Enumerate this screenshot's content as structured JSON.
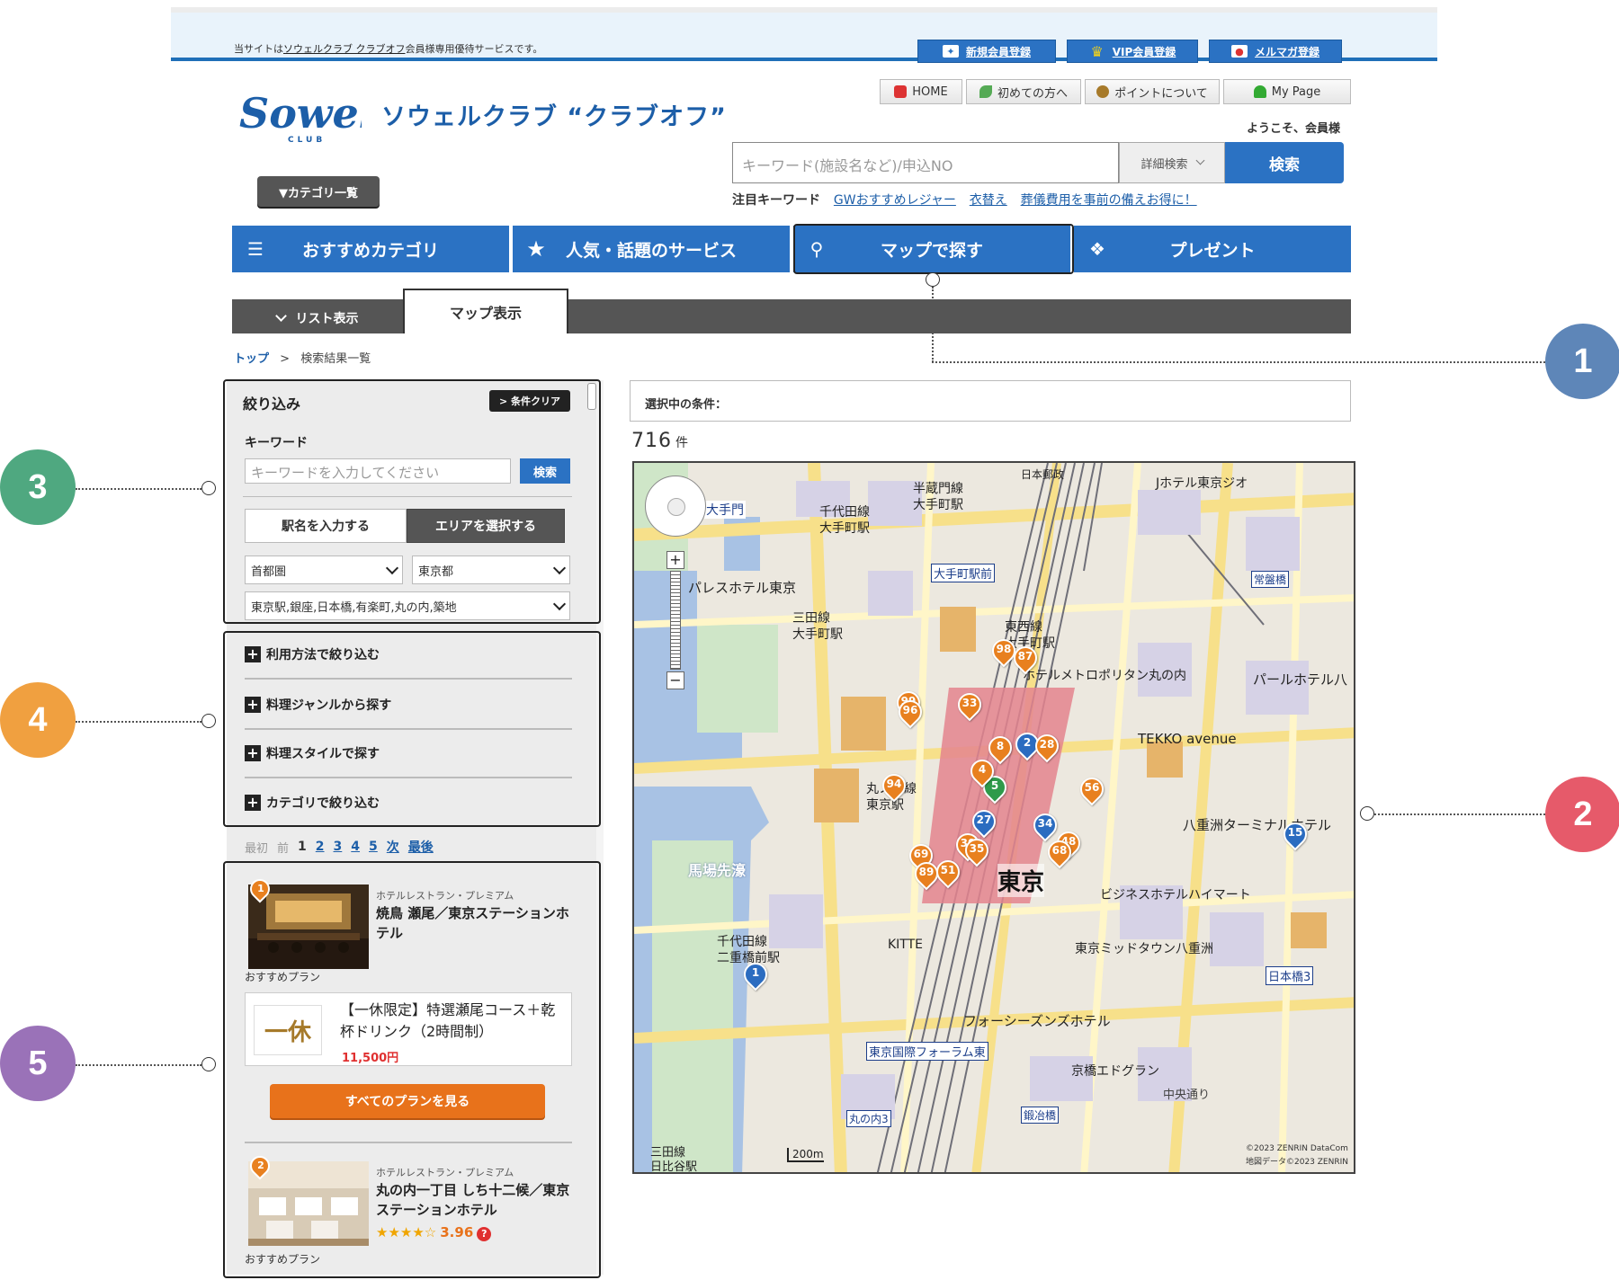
{
  "topbar": {
    "notice_pre": "当サイトは",
    "notice_link": "ソウェルクラブ クラブオフ",
    "notice_post": "会員様専用優待サービスです。",
    "buttons": [
      {
        "label": "新規会員登録",
        "icon": "new-member-icon"
      },
      {
        "label": "VIP会員登録",
        "icon": "crown-icon"
      },
      {
        "label": "メルマガ登録",
        "icon": "mail-icon"
      }
    ]
  },
  "header": {
    "logo_text": "Sowel",
    "logo_sub": "CLUB",
    "site_title": "ソウェルクラブ “クラブオフ”",
    "util_nav": [
      {
        "label": "HOME",
        "icon": "home-icon",
        "color": "#d33"
      },
      {
        "label": "初めての方へ",
        "icon": "leaf-icon",
        "color": "#5a5"
      },
      {
        "label": "ポイントについて",
        "icon": "point-icon",
        "color": "#a77a2a"
      },
      {
        "label": "My Page",
        "icon": "user-icon",
        "color": "#3a3"
      }
    ],
    "welcome": "ようこそ、会員様",
    "category_button": "▼カテゴリ一覧"
  },
  "search": {
    "placeholder": "キーワード(施設名など)/申込NO",
    "detail_label": "詳細検索",
    "button_label": "検索",
    "keywords_label": "注目キーワード",
    "keywords": [
      "GWおすすめレジャー",
      "衣替え",
      "葬儀費用を事前の備えお得に！"
    ]
  },
  "main_nav": [
    {
      "label": "おすすめカテゴリ",
      "icon": "list-icon"
    },
    {
      "label": "人気・話題のサービス",
      "icon": "star-icon"
    },
    {
      "label": "マップで探す",
      "icon": "map-pin-icon"
    },
    {
      "label": "プレゼント",
      "icon": "gift-icon"
    }
  ],
  "tabs": {
    "list": "リスト表示",
    "map": "マップ表示"
  },
  "breadcrumb": {
    "top": "トップ",
    "sep": ">",
    "current": "検索結果一覧"
  },
  "filter": {
    "title": "絞り込み",
    "clear": "> 条件クリア",
    "keyword_label": "キーワード",
    "keyword_placeholder": "キーワードを入力してください",
    "keyword_search": "検索",
    "seg_station": "駅名を入力する",
    "seg_area": "エリアを選択する",
    "region": "首都圏",
    "prefecture": "東京都",
    "area": "東京駅,銀座,日本橋,有楽町,丸の内,築地",
    "accordions": [
      "利用方法で絞り込む",
      "料理ジャンルから探す",
      "料理スタイルで探す",
      "カテゴリで絞り込む"
    ]
  },
  "pager": {
    "first": "最初",
    "prev": "前",
    "current": "1",
    "pages": [
      "2",
      "3",
      "4",
      "5"
    ],
    "next": "次",
    "last": "最後"
  },
  "results": [
    {
      "rank": "1",
      "subtitle": "ホテルレストラン・プレミアム",
      "title": "焼鳥 瀬尾／東京ステーションホテル",
      "recommended": "おすすめプラン",
      "plan_logo": "一休",
      "plan_text": "【一休限定】特選瀬尾コース＋乾杯ドリンク（2時間制）",
      "plan_price": "11,500円",
      "all_plans": "すべてのプランを見る"
    },
    {
      "rank": "2",
      "subtitle": "ホテルレストラン・プレミアム",
      "title": "丸の内一丁目 しち十二候／東京ステーションホテル",
      "stars": "★★★★☆",
      "rating": "3.96",
      "rating_help": "?",
      "recommended": "おすすめプラン"
    }
  ],
  "conditions": {
    "label": "選択中の条件："
  },
  "count": {
    "value": "716",
    "unit": "件"
  },
  "map": {
    "labels": [
      "日本郵政",
      "Jホテル東京ジオ",
      "半蔵門線",
      "大手町駅",
      "千代田線",
      "大手町駅",
      "大手門",
      "大手町駅前",
      "パレスホテル東京",
      "三田線",
      "大手町駅",
      "東西線",
      "大手町駅",
      "ホテルメトロポリタン丸の内",
      "パールホテル八",
      "TEKKO avenue",
      "丸ノ内線",
      "東京駅",
      "馬場先濠",
      "八重洲ターミナルホテル",
      "東京",
      "ビジネスホテルハイマート",
      "千代田線",
      "二重橋前駅",
      "KITTE",
      "東京ミッドタウン八重洲",
      "日本橋3",
      "フォーシーズンズホテル",
      "東京国際フォーラム東",
      "京橋エドグラン",
      "中央通り",
      "鍛冶橋",
      "丸の内3",
      "三田線",
      "日比谷駅",
      "常盤橋",
      "200m",
      "©2023 ZENRIN DataCom",
      "地図データ©2023 ZENRIN"
    ],
    "pins": [
      "98",
      "87",
      "99",
      "33",
      "8",
      "2",
      "28",
      "94",
      "5",
      "27",
      "34",
      "56",
      "30",
      "69",
      "89",
      "51",
      "35",
      "48",
      "68",
      "1",
      "15",
      "96",
      "4"
    ]
  },
  "callouts": [
    "1",
    "2",
    "3",
    "4",
    "5"
  ],
  "colors": {
    "primary": "#2b72c3",
    "orange": "#e8801f",
    "callout1": "#5e86b8",
    "callout2": "#e65a6a",
    "callout3": "#4fa880",
    "callout4": "#f0a040",
    "callout5": "#9a72b8"
  }
}
